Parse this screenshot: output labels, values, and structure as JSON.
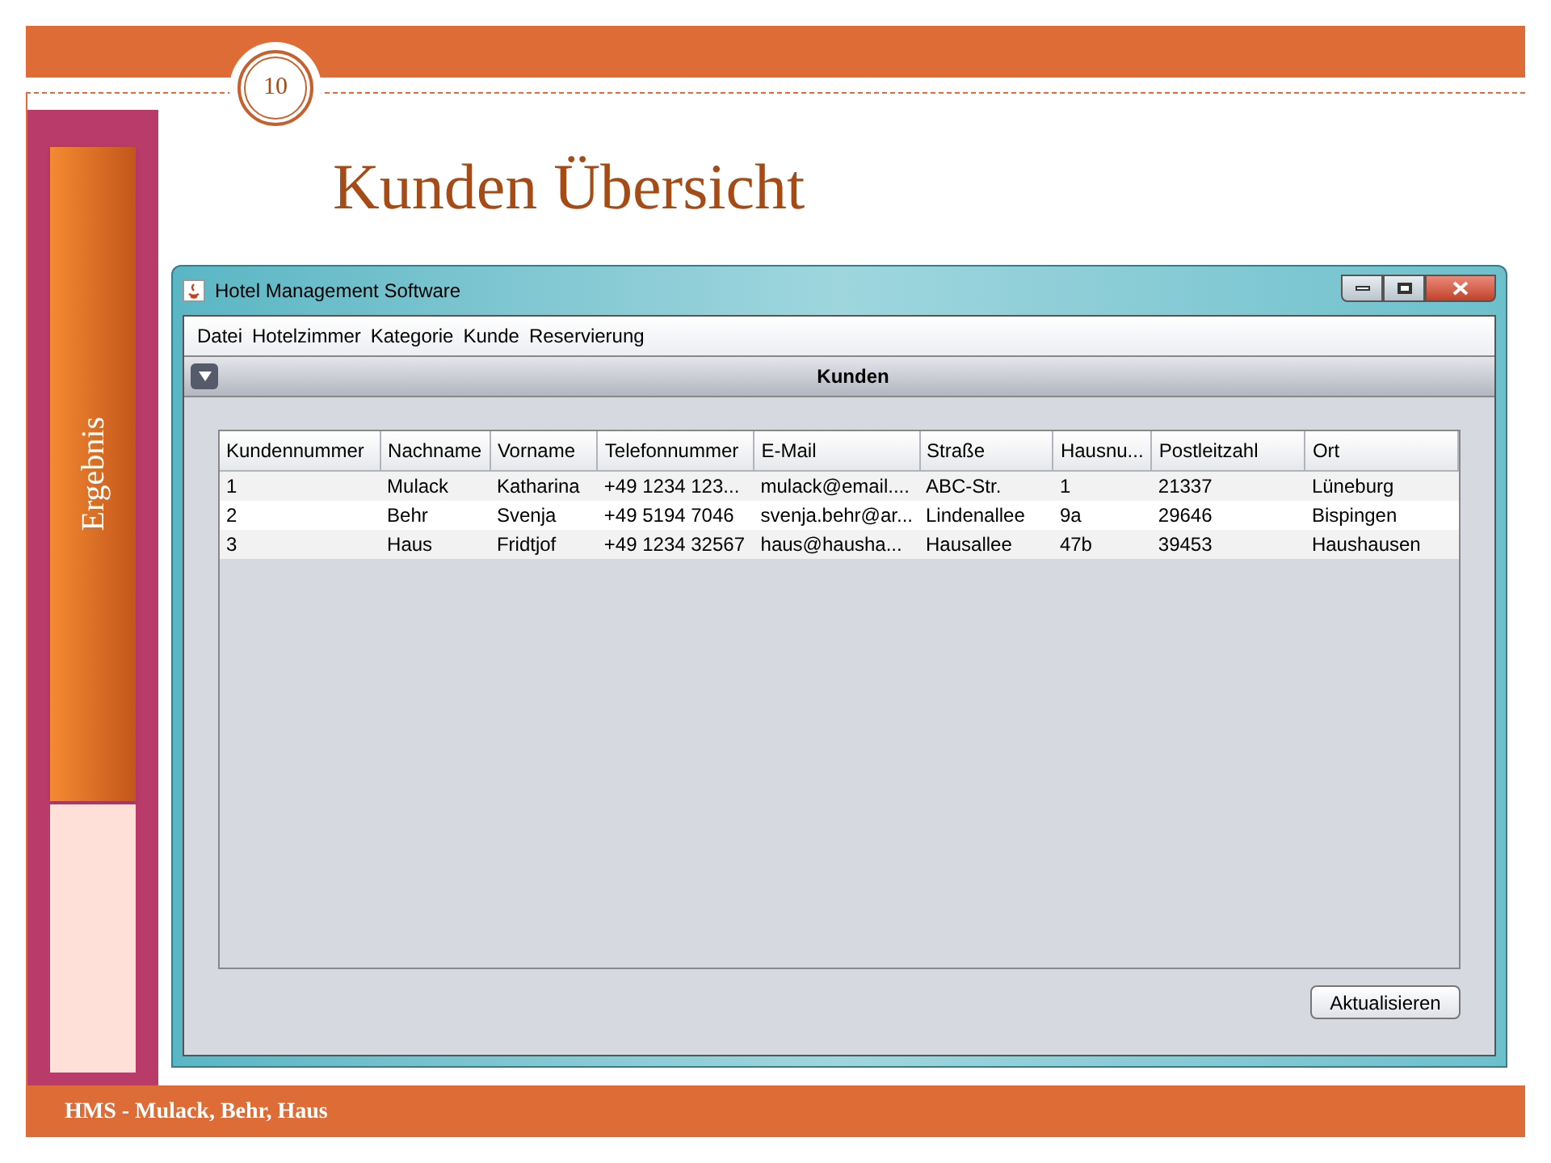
{
  "slide": {
    "page_number": "10",
    "sidebar_label": "Ergebnis",
    "title": "Kunden Übersicht",
    "footer": "HMS - Mulack, Behr, Haus"
  },
  "window": {
    "title": "Hotel Management Software",
    "menu": [
      "Datei",
      "Hotelzimmer",
      "Kategorie",
      "Kunde",
      "Reservierung"
    ],
    "panel_title": "Kunden",
    "table": {
      "columns": [
        "Kundennummer",
        "Nachname",
        "Vorname",
        "Telefonnummer",
        "E-Mail",
        "Straße",
        "Hausnu...",
        "Postleitzahl",
        "Ort"
      ],
      "rows": [
        [
          "1",
          "Mulack",
          "Katharina",
          "+49 1234 123...",
          "mulack@email....",
          "ABC-Str.",
          "1",
          "21337",
          "Lüneburg"
        ],
        [
          "2",
          "Behr",
          "Svenja",
          "+49 5194 7046",
          "svenja.behr@ar...",
          "Lindenallee",
          "9a",
          "29646",
          "Bispingen"
        ],
        [
          "3",
          "Haus",
          "Fridtjof",
          "+49 1234 32567",
          "haus@hausha...",
          "Hausallee",
          "47b",
          "39453",
          "Haushausen"
        ]
      ]
    },
    "button": "Aktualisieren"
  }
}
